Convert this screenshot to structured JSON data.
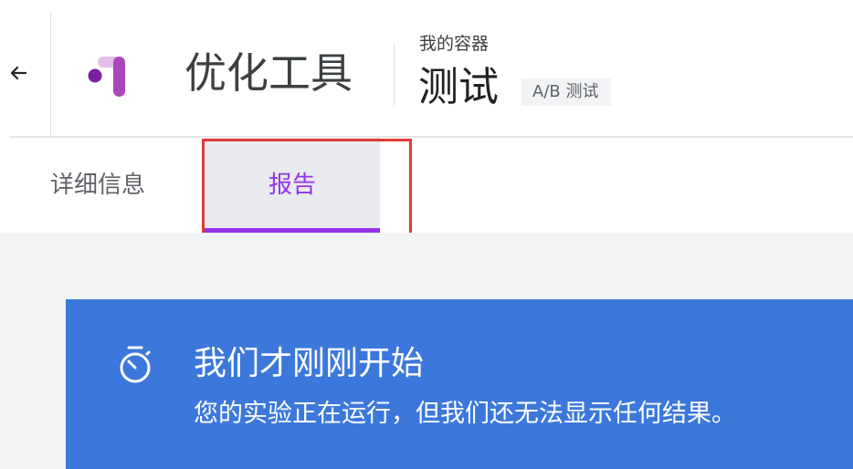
{
  "header": {
    "back_icon": "arrow-back-icon",
    "logo_icon": "optimize-logo-icon",
    "app_title": "优化工具",
    "container_label": "我的容器",
    "experiment_name": "测试",
    "experiment_type_badge": "A/B 测试"
  },
  "tabs": [
    {
      "label": "详细信息",
      "active": false
    },
    {
      "label": "报告",
      "active": true
    }
  ],
  "banner": {
    "icon": "timer-icon",
    "title": "我们才刚刚开始",
    "subtitle": "您的实验正在运行，但我们还无法显示任何结果。"
  },
  "colors": {
    "accent": "#9334e6",
    "banner_bg": "#3c78dc",
    "highlight": "#e53935",
    "content_bg": "#f1f3f4"
  }
}
